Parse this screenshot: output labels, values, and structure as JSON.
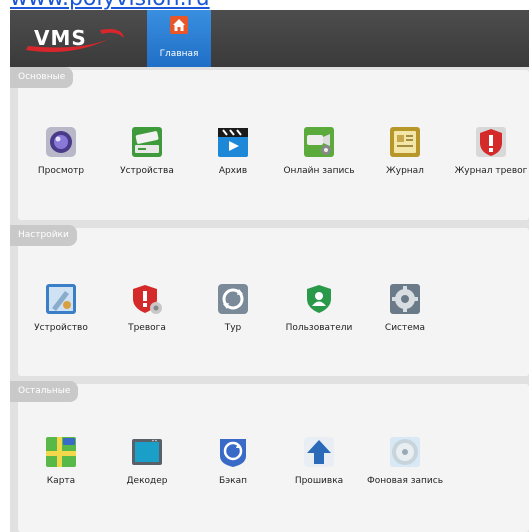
{
  "watermark": "www.polyvision.ru",
  "header": {
    "logo_text": "VMS",
    "home_tab": {
      "label": "Главная",
      "icon": "home-icon"
    }
  },
  "sections": [
    {
      "title": "Основные",
      "items": [
        {
          "label": "Просмотр",
          "icon": "camera-lens-icon"
        },
        {
          "label": "Устройства",
          "icon": "dvr-device-icon"
        },
        {
          "label": "Архив",
          "icon": "playback-clapper-icon"
        },
        {
          "label": "Онлайн запись",
          "icon": "record-camera-icon"
        },
        {
          "label": "Журнал",
          "icon": "log-book-icon"
        },
        {
          "label": "Журнал тревог",
          "icon": "alarm-log-icon"
        }
      ]
    },
    {
      "title": "Настройки",
      "items": [
        {
          "label": "Устройство",
          "icon": "device-config-icon"
        },
        {
          "label": "Тревога",
          "icon": "alarm-settings-icon"
        },
        {
          "label": "Тур",
          "icon": "tour-cycle-icon"
        },
        {
          "label": "Пользователи",
          "icon": "users-icon"
        },
        {
          "label": "Система",
          "icon": "system-gear-icon"
        }
      ]
    },
    {
      "title": "Остальные",
      "items": [
        {
          "label": "Карта",
          "icon": "map-icon"
        },
        {
          "label": "Декодер",
          "icon": "decoder-monitor-icon"
        },
        {
          "label": "Бэкап",
          "icon": "backup-icon"
        },
        {
          "label": "Прошивка",
          "icon": "upgrade-arrow-icon"
        },
        {
          "label": "Фоновая запись",
          "icon": "disc-record-icon"
        }
      ]
    }
  ]
}
